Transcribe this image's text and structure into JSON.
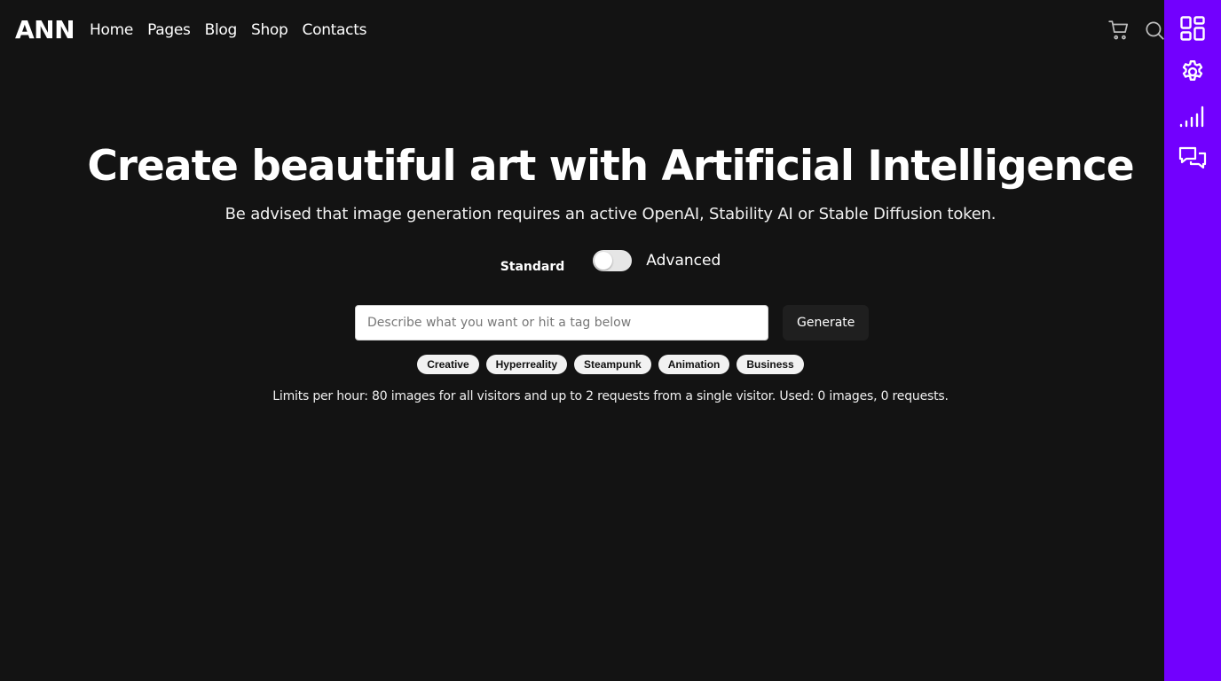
{
  "header": {
    "logo": "ANN",
    "nav": [
      "Home",
      "Pages",
      "Blog",
      "Shop",
      "Contacts"
    ],
    "icons": [
      "cart-icon",
      "search-icon"
    ]
  },
  "sidebar": {
    "icons": [
      "dashboard-icon",
      "gear-icon",
      "signal-icon",
      "chat-icon"
    ],
    "accent_color": "#7200fe"
  },
  "hero": {
    "title": "Create beautiful art with Artificial Intelligence",
    "subtitle": "Be advised that image generation requires an active OpenAI, Stability AI or Stable Diffusion token."
  },
  "mode_toggle": {
    "standard_label": "Standard",
    "advanced_label": "Advanced",
    "is_advanced": false
  },
  "prompt": {
    "placeholder": "Describe what you want or hit a tag below",
    "value": "",
    "generate_label": "Generate"
  },
  "tags": [
    "Creative",
    "Hyperreality",
    "Steampunk",
    "Animation",
    "Business"
  ],
  "limits_text": "Limits per hour: 80 images for all visitors and up to 2 requests from a single visitor. Used: 0 images, 0 requests."
}
